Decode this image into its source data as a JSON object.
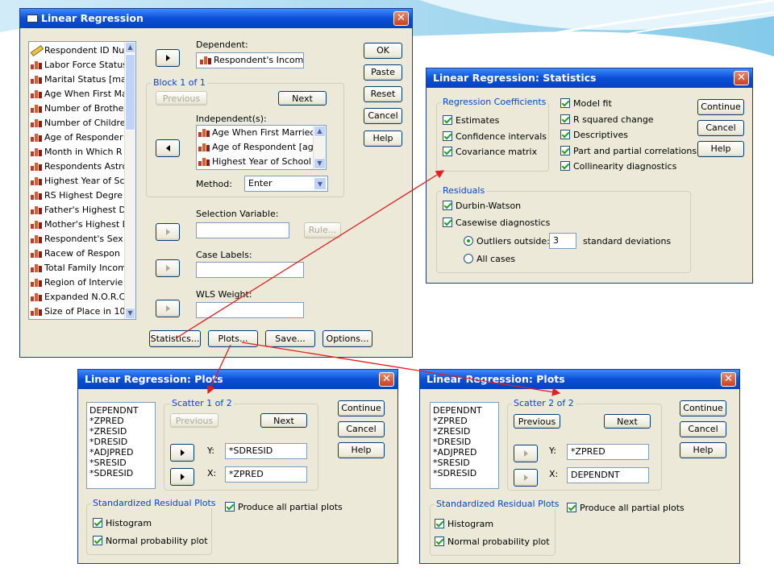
{
  "main": {
    "title": "Linear Regression",
    "variables": [
      {
        "label": "Respondent ID Nu",
        "icon": "ruler-icon"
      },
      {
        "label": "Labor Force Status",
        "icon": "bar-chart-icon"
      },
      {
        "label": "Marital Status [mar",
        "icon": "bar-chart-icon"
      },
      {
        "label": "Age When First Ma",
        "icon": "bar-chart-icon"
      },
      {
        "label": "Number of Brothers",
        "icon": "bar-chart-icon"
      },
      {
        "label": "Number of Children",
        "icon": "bar-chart-icon"
      },
      {
        "label": "Age of Responder",
        "icon": "bar-chart-icon"
      },
      {
        "label": "Month in Which R",
        "icon": "bar-chart-icon"
      },
      {
        "label": "Respondents Astro",
        "icon": "bar-chart-icon"
      },
      {
        "label": "Highest Year of Sc",
        "icon": "bar-chart-icon"
      },
      {
        "label": "RS Highest Degre",
        "icon": "bar-chart-icon"
      },
      {
        "label": "Father's Highest D",
        "icon": "bar-chart-icon"
      },
      {
        "label": "Mother's Highest D",
        "icon": "bar-chart-icon"
      },
      {
        "label": "Respondent's Sex",
        "icon": "bar-chart-icon"
      },
      {
        "label": "Racew of Respon",
        "icon": "bar-chart-icon"
      },
      {
        "label": "Total Family Incom",
        "icon": "bar-chart-icon"
      },
      {
        "label": "Region of Intervie",
        "icon": "bar-chart-icon"
      },
      {
        "label": "Expanded N.O.R.C",
        "icon": "bar-chart-icon"
      },
      {
        "label": "Size of Place in 10",
        "icon": "bar-chart-icon"
      }
    ],
    "dependent_label": "Dependent:",
    "dependent_value": "Respondent's Income",
    "block_label": "Block 1 of 1",
    "previous": "Previous",
    "next": "Next",
    "independent_label": "Independent(s):",
    "independents": [
      "Age When First Married",
      "Age of Respondent [age",
      "Highest Year of School C"
    ],
    "method_label": "Method:",
    "method_value": "Enter",
    "selection_label": "Selection Variable:",
    "rule": "Rule...",
    "case_labels": "Case Labels:",
    "wls_label": "WLS Weight:",
    "side_buttons": [
      "OK",
      "Paste",
      "Reset",
      "Cancel",
      "Help"
    ],
    "bottom_buttons": [
      "Statistics...",
      "Plots...",
      "Save...",
      "Options..."
    ]
  },
  "stats": {
    "title": "Linear Regression: Statistics",
    "coef_group": "Regression Coefficients",
    "coef_items": [
      "Estimates",
      "Confidence intervals",
      "Covariance matrix"
    ],
    "right_items": [
      "Model fit",
      "R squared change",
      "Descriptives",
      "Part and partial correlations",
      "Collinearity diagnostics"
    ],
    "residuals_group": "Residuals",
    "durbin": "Durbin-Watson",
    "casewise": "Casewise diagnostics",
    "outliers": "Outliers outside:",
    "outliers_value": "3",
    "std_dev": "standard deviations",
    "all_cases": "All cases",
    "buttons": [
      "Continue",
      "Cancel",
      "Help"
    ]
  },
  "plots1": {
    "title": "Linear Regression: Plots",
    "list": [
      "DEPENDNT",
      "*ZPRED",
      "*ZRESID",
      "*DRESID",
      "*ADJPRED",
      "*SRESID",
      "*SDRESID"
    ],
    "scatter": "Scatter 1 of 2",
    "previous": "Previous",
    "next": "Next",
    "y_label": "Y:",
    "y_value": "*SDRESID",
    "x_label": "X:",
    "x_value": "*ZPRED",
    "std_group": "Standardized Residual Plots",
    "histogram": "Histogram",
    "normal": "Normal probability plot",
    "partial": "Produce all partial plots",
    "buttons": [
      "Continue",
      "Cancel",
      "Help"
    ]
  },
  "plots2": {
    "title": "Linear Regression: Plots",
    "list": [
      "DEPENDNT",
      "*ZPRED",
      "*ZRESID",
      "*DRESID",
      "*ADJPRED",
      "*SRESID",
      "*SDRESID"
    ],
    "scatter": "Scatter 2 of 2",
    "previous": "Previous",
    "next": "Next",
    "y_label": "Y:",
    "y_value": "*ZPRED",
    "x_label": "X:",
    "x_value": "DEPENDNT",
    "std_group": "Standardized Residual Plots",
    "histogram": "Histogram",
    "normal": "Normal probability plot",
    "partial": "Produce all partial plots",
    "buttons": [
      "Continue",
      "Cancel",
      "Help"
    ]
  },
  "colors": {
    "titlebar": "#0a4fd6",
    "dialog": "#ece9d8",
    "arrow": "#e02020",
    "group_label": "#0046d5"
  }
}
